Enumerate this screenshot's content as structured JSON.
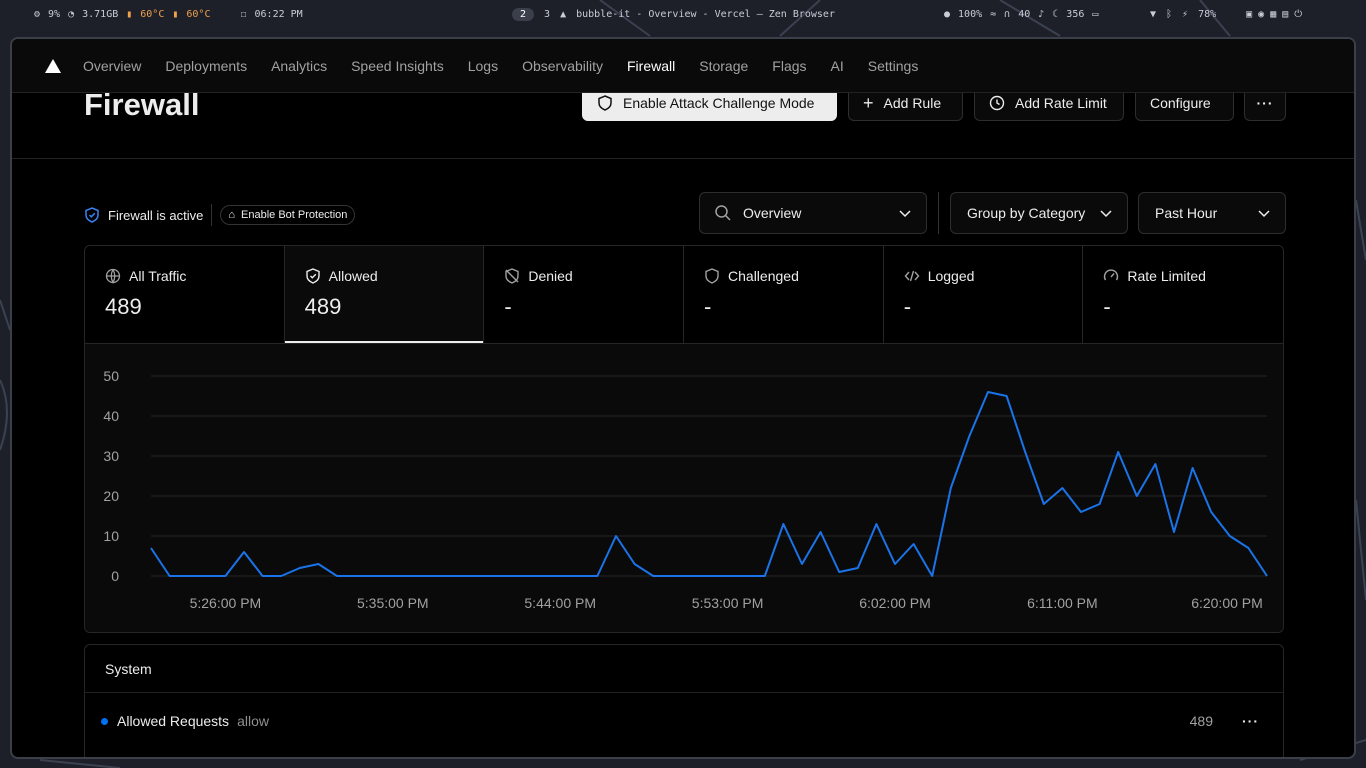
{
  "system_bar": {
    "cpu": "9%",
    "memory": "3.71GB",
    "temp1": "60°C",
    "temp2": "60°C",
    "clock": "06:22 PM",
    "workspaces": [
      "2",
      "3"
    ],
    "window_title": "bubble-it - Overview - Vercel — Zen Browser",
    "brightness": "100%",
    "volume": "40",
    "mic_value": "356",
    "battery": "78%"
  },
  "nav": {
    "tabs": [
      "Overview",
      "Deployments",
      "Analytics",
      "Speed Insights",
      "Logs",
      "Observability",
      "Firewall",
      "Storage",
      "Flags",
      "AI",
      "Settings"
    ],
    "active": "Firewall"
  },
  "header": {
    "title": "Firewall",
    "attack_mode_label": "Enable Attack Challenge Mode",
    "add_rule_label": "Add Rule",
    "add_rate_limit_label": "Add Rate Limit",
    "configure_label": "Configure"
  },
  "controls": {
    "status_text": "Firewall is active",
    "bot_protection_label": "Enable Bot Protection",
    "view_select": "Overview",
    "group_select": "Group by Category",
    "time_select": "Past Hour"
  },
  "stats": [
    {
      "label": "All Traffic",
      "value": "489",
      "icon": "globe-icon"
    },
    {
      "label": "Allowed",
      "value": "489",
      "icon": "shield-check-icon"
    },
    {
      "label": "Denied",
      "value": "-",
      "icon": "shield-off-icon"
    },
    {
      "label": "Challenged",
      "value": "-",
      "icon": "shield-icon"
    },
    {
      "label": "Logged",
      "value": "-",
      "icon": "code-icon"
    },
    {
      "label": "Rate Limited",
      "value": "-",
      "icon": "gauge-icon"
    }
  ],
  "chart_data": {
    "type": "line",
    "y_ticks": [
      50,
      40,
      30,
      20,
      10,
      0
    ],
    "ylim": [
      0,
      50
    ],
    "x_tick_labels": [
      "5:26:00 PM",
      "5:35:00 PM",
      "5:44:00 PM",
      "5:53:00 PM",
      "6:02:00 PM",
      "6:11:00 PM",
      "6:20:00 PM"
    ],
    "x_tick_index": [
      4,
      13,
      22,
      31,
      40,
      49,
      58
    ],
    "grid": true,
    "color": "#1a73e8",
    "values": [
      7,
      0,
      0,
      0,
      0,
      6,
      0,
      0,
      2,
      3,
      0,
      0,
      0,
      0,
      0,
      0,
      0,
      0,
      0,
      0,
      0,
      0,
      0,
      0,
      0,
      10,
      3,
      0,
      0,
      0,
      0,
      0,
      0,
      0,
      13,
      3,
      11,
      1,
      2,
      13,
      3,
      8,
      0,
      22,
      35,
      46,
      45,
      31,
      18,
      22,
      16,
      18,
      31,
      20,
      28,
      11,
      27,
      16,
      10,
      7,
      0
    ]
  },
  "system_panel": {
    "heading": "System",
    "row_label": "Allowed Requests",
    "row_tag": "allow",
    "row_count": "489"
  }
}
